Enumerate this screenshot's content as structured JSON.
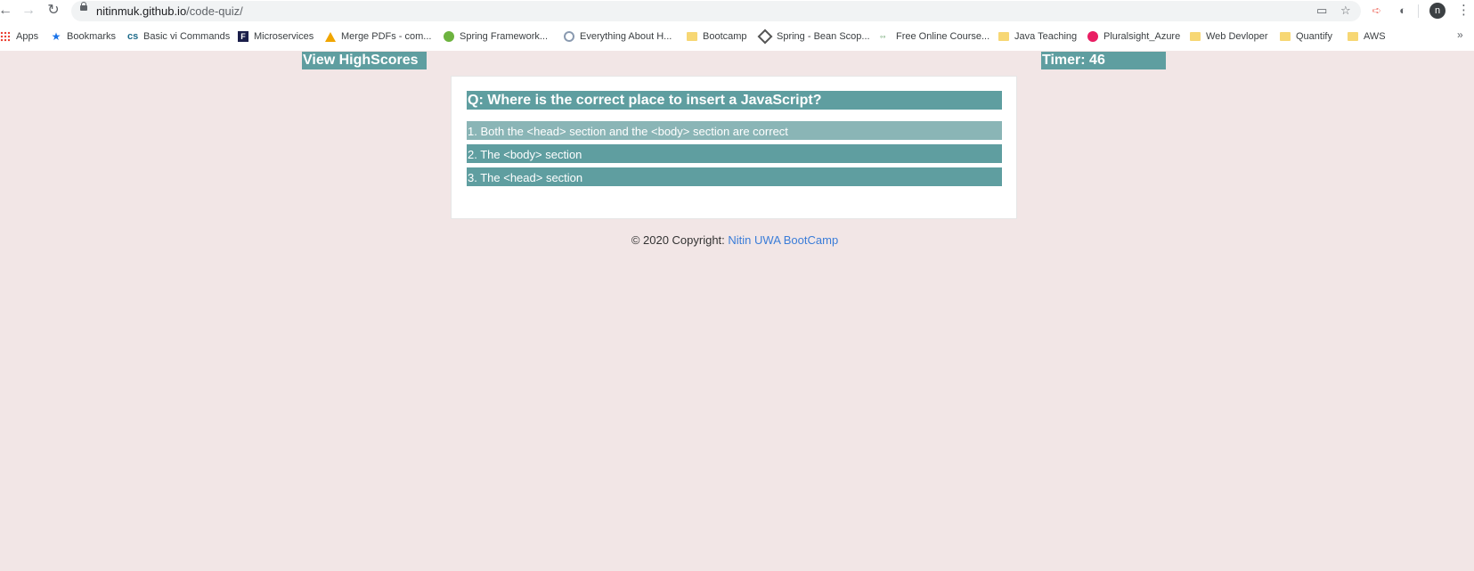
{
  "browser": {
    "url_host": "nitinmuk.github.io",
    "url_path": "/code-quiz/",
    "avatar_letter": "n",
    "bookmarks": [
      {
        "label": "Apps",
        "icon": "apps-icon"
      },
      {
        "label": "Bookmarks",
        "icon": "star-icon"
      },
      {
        "label": "Basic vi Commands",
        "icon": "cs-icon"
      },
      {
        "label": "Microservices",
        "icon": "f-icon"
      },
      {
        "label": "Merge PDFs - com...",
        "icon": "warning-triangle-icon"
      },
      {
        "label": "Spring Framework...",
        "icon": "spring-leaf-icon"
      },
      {
        "label": "Everything About H...",
        "icon": "gear-icon"
      },
      {
        "label": "Bootcamp",
        "icon": "folder-icon"
      },
      {
        "label": "Spring - Bean Scop...",
        "icon": "diamond-icon"
      },
      {
        "label": "Free Online Course...",
        "icon": "glasses-icon"
      },
      {
        "label": "Java Teaching",
        "icon": "folder-icon"
      },
      {
        "label": "Pluralsight_Azure",
        "icon": "pluralsight-icon"
      },
      {
        "label": "Web Devloper",
        "icon": "folder-icon"
      },
      {
        "label": "Quantify",
        "icon": "folder-icon"
      },
      {
        "label": "AWS",
        "icon": "folder-icon"
      }
    ],
    "more_label": "»"
  },
  "header": {
    "highscores_label": "View HighScores",
    "timer_label": "Timer: 46"
  },
  "quiz": {
    "question": "Q: Where is the correct place to insert a JavaScript?",
    "answers": [
      "1. Both the <head> section and the <body> section are correct",
      "2. The <body> section",
      "3. The <head> section"
    ]
  },
  "footer": {
    "copyright": "© 2020 Copyright: ",
    "link_text": "Nitin UWA BootCamp"
  },
  "colors": {
    "accent": "#5f9ea0",
    "accent_hover": "#8ab5b6",
    "page_bg": "#f2e6e6",
    "link": "#3b7dd8"
  }
}
